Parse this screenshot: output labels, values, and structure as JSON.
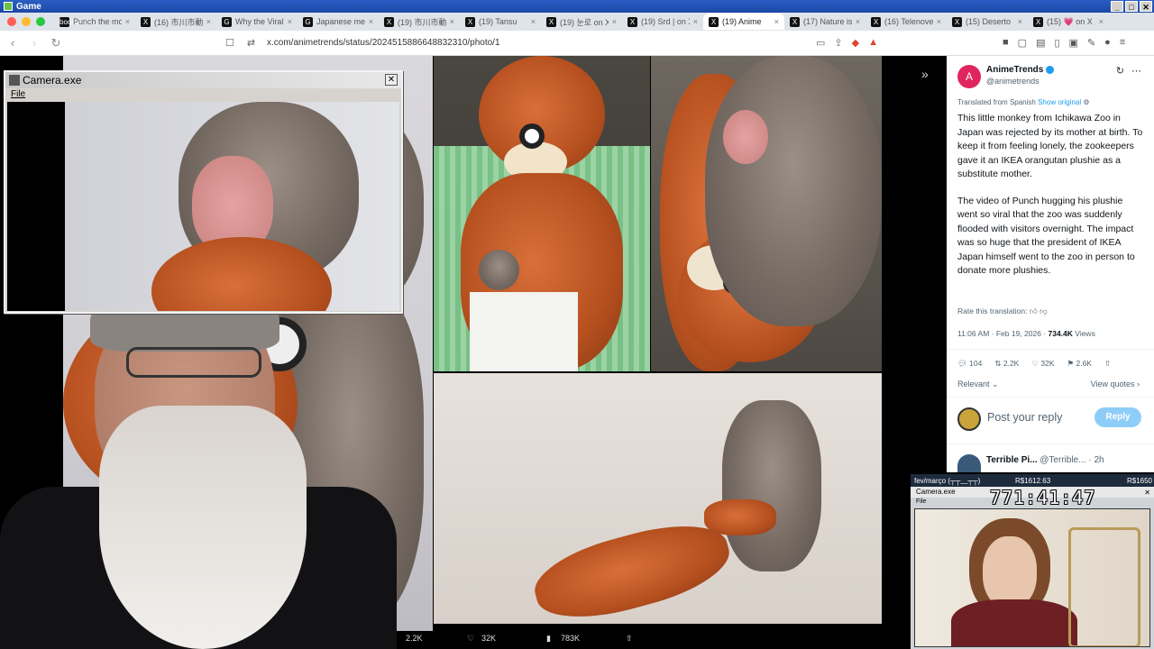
{
  "outer_window": {
    "title": "Game"
  },
  "browser": {
    "tabs": [
      {
        "label": "Punch the mo",
        "icon": "bookmark"
      },
      {
        "label": "(16) 市川市動",
        "icon": "X"
      },
      {
        "label": "Why the Viral",
        "icon": "G"
      },
      {
        "label": "Japanese me",
        "icon": "G"
      },
      {
        "label": "(19) 市川市動",
        "icon": "X"
      },
      {
        "label": "(19) Tansu",
        "icon": "X"
      },
      {
        "label": "(19) 눈로 on X",
        "icon": "X"
      },
      {
        "label": "(19) Srd | on X",
        "icon": "X"
      },
      {
        "label": "(19) Anime",
        "icon": "X",
        "active": true
      },
      {
        "label": "(17) Nature is",
        "icon": "X"
      },
      {
        "label": "(16) Telenovel",
        "icon": "X"
      },
      {
        "label": "(15) Deserto",
        "icon": "X"
      },
      {
        "label": "(15) 💗 on X",
        "icon": "X"
      }
    ],
    "url": "x.com/animetrends/status/2024515886648832310/photo/1"
  },
  "tweet": {
    "author": "AnimeTrends",
    "handle": "@animetrends",
    "translated_label": "Translated from Spanish",
    "show_original": "Show original",
    "paragraph1": "This little monkey from Ichikawa Zoo in Japan was rejected by its mother at birth. To keep it from feeling lonely, the zookeepers gave it an IKEA orangutan plushie as a substitute mother.",
    "paragraph2": "The video of Punch hugging his plushie went so viral that the zoo was suddenly flooded with visitors overnight. The impact was so huge that the president of IKEA Japan himself went to the zoo in person to donate more plushies.",
    "rate_label": "Rate this translation:",
    "timestamp": "11:06 AM · Feb 19, 2026 ·",
    "views_count": "734.4K",
    "views_label": "Views",
    "stats": {
      "replies": "104",
      "reposts": "2.2K",
      "likes": "32K",
      "bookmarks": "2.6K"
    },
    "relevant_label": "Relevant",
    "view_quotes_label": "View quotes",
    "reply_placeholder": "Post your reply",
    "reply_button": "Reply",
    "comment": {
      "name": "Terrible Pi...",
      "handle": "@Terrible...",
      "time": "· 2h"
    }
  },
  "viewer_bar": {
    "reposts": "2.2K",
    "likes": "32K",
    "views": "783K"
  },
  "camera_window": {
    "title": "Camera.exe",
    "menu_file": "File"
  },
  "overlay": {
    "label": "fev/março (┬┬﹏┬┬)",
    "price1": "R$1612.63",
    "price2": "R$1650",
    "window_title": "Camera.exe",
    "menu_file": "File",
    "timer": "771:41:47"
  }
}
